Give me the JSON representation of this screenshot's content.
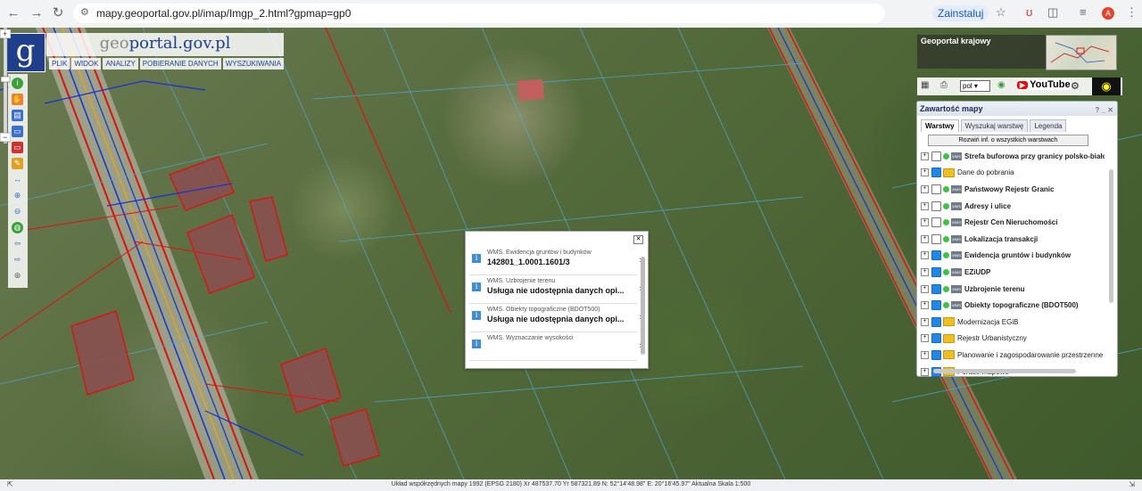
{
  "browser": {
    "url": "mapy.geoportal.gov.pl/imap/Imgp_2.html?gpmap=gp0",
    "install_label": "Zainstaluj",
    "avatar_letter": "A"
  },
  "site": {
    "title_part1": "geo",
    "title_part2": "portal.gov.pl",
    "logo_letter": "g",
    "menu": [
      "PLIK",
      "WIDOK",
      "ANALIZY",
      "POBIERANIE DANYCH",
      "WYSZUKIWANIA"
    ]
  },
  "right_top": {
    "geoportal_krajowy": "Geoportal krajowy",
    "language": "pol",
    "youtube": "YouTube"
  },
  "layers_panel": {
    "title": "Zawartość mapy",
    "controls": "? _ ✕",
    "tabs": [
      "Warstwy",
      "Wyszukaj warstwę",
      "Legenda"
    ],
    "expand_button": "Rozwiń inf. o wszystkich warstwach",
    "layers": [
      {
        "label": "Strefa buforowa przy granicy polsko-białoruskiej",
        "checked": false,
        "type": "wms",
        "bold": true
      },
      {
        "label": "Dane do pobrania",
        "checked": true,
        "type": "folder",
        "bold": false
      },
      {
        "label": "Państwowy Rejestr Granic",
        "checked": false,
        "type": "wms",
        "bold": true
      },
      {
        "label": "Adresy i ulice",
        "checked": false,
        "type": "wms",
        "bold": true
      },
      {
        "label": "Rejestr Cen Nieruchomości",
        "checked": false,
        "type": "wms",
        "bold": true
      },
      {
        "label": "Lokalizacja transakcji",
        "checked": false,
        "type": "wms",
        "bold": true
      },
      {
        "label": "Ewidencja gruntów i budynków",
        "checked": true,
        "type": "wms",
        "bold": true
      },
      {
        "label": "EZiUDP",
        "checked": true,
        "type": "wms",
        "bold": true
      },
      {
        "label": "Uzbrojenie terenu",
        "checked": true,
        "type": "wms",
        "bold": true
      },
      {
        "label": "Obiekty topograficzne (BDOT500)",
        "checked": true,
        "type": "wms",
        "bold": true
      },
      {
        "label": "Modernizacja EGiB",
        "checked": true,
        "type": "folder",
        "bold": false
      },
      {
        "label": "Rejestr Urbanistyczny",
        "checked": true,
        "type": "folder",
        "bold": false
      },
      {
        "label": "Planowanie i zagospodarowanie przestrzenne",
        "checked": true,
        "type": "folder",
        "bold": false
      },
      {
        "label": "Portale mapowe",
        "checked": true,
        "type": "folder",
        "bold": false
      }
    ]
  },
  "popup": {
    "items": [
      {
        "sub": "WMS. Ewidencja gruntów i budynków",
        "main": "142801_1.0001.1601/3"
      },
      {
        "sub": "WMS. Uzbrojenie terenu",
        "main": "Usługa nie udostępnia danych opi..."
      },
      {
        "sub": "WMS. Obiekty topograficzne (BDOT500)",
        "main": "Usługa nie udostępnia danych opi..."
      },
      {
        "sub": "WMS. Wyznaczanie wysokości",
        "main": ""
      }
    ]
  },
  "status": {
    "text": "Układ współrzędnych mapy 1992 (EPSG 2180)   Xr 487537.70 Yr 587321.89   N: 52°14'48.98\" E: 20°16'45.97\"   Aktualna Skala 1:500"
  },
  "colors": {
    "brand_blue": "#1f3e8c",
    "parcel_red": "#e01010",
    "utility_blue": "#1530d8",
    "checkbox_blue": "#1e88e5"
  }
}
